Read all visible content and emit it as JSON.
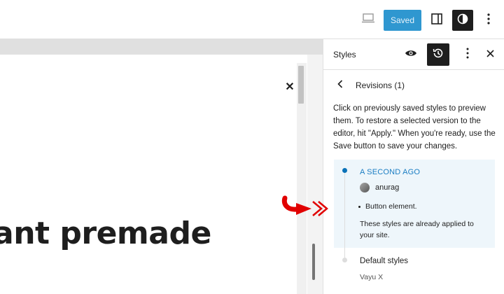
{
  "topbar": {
    "saved_label": "Saved",
    "icons": [
      "desktop-icon",
      "sidebar-panel-icon",
      "half-circle-styles-icon",
      "vertical-dots-icon"
    ]
  },
  "canvas": {
    "heading_text": "ant premade",
    "close_glyph": "✕"
  },
  "sidebar": {
    "title": "Styles",
    "icons": [
      "eye-icon",
      "revisions-icon",
      "more-icon",
      "close-icon"
    ],
    "revisions_title": "Revisions (1)",
    "description": "Click on previously saved styles to preview them. To restore a selected version to the editor, hit \"Apply.\" When you're ready, use the Save button to save your changes.",
    "revision": {
      "time": "A SECOND AGO",
      "author": "anurag",
      "change": "Button element.",
      "note": "These styles are already applied to your site."
    },
    "default_label": "Default styles",
    "theme_name": "Vayu X"
  },
  "colors": {
    "accent": "#1a7dc3",
    "saved_bg": "#2f97d0",
    "annotation": "#e10000"
  }
}
